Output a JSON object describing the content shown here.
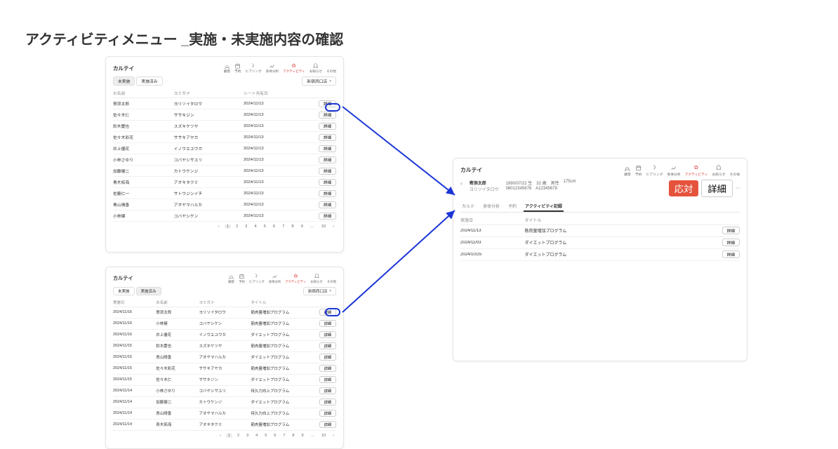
{
  "page_title": "アクティビティメニュー _実施・未実施内容の確認",
  "brand": "カルテイ",
  "toolbar_icons": [
    "顧客",
    "予約",
    "ヒアリング",
    "身体分析",
    "アクティビティ",
    "お知らせ",
    "その他"
  ],
  "shop_dropdown": "新宿西口店",
  "tabs": {
    "pending": "未実施",
    "done": "実施済み"
  },
  "top": {
    "active_tab": "pending",
    "columns": [
      "お名前",
      "ヨミガナ",
      "シート共有日"
    ],
    "rows": [
      {
        "name": "寄添太郎",
        "kana": "ヨリソイタロウ",
        "date": "2024/11/13"
      },
      {
        "name": "佐々木仁",
        "kana": "ササキジン",
        "date": "2024/11/13"
      },
      {
        "name": "鈴木慶也",
        "kana": "スズキケツヤ",
        "date": "2024/11/13"
      },
      {
        "name": "佐々木彩花",
        "kana": "ササキアヤカ",
        "date": "2024/11/13"
      },
      {
        "name": "井上優花",
        "kana": "イノウエユウカ",
        "date": "2024/11/13"
      },
      {
        "name": "小林さゆり",
        "kana": "コバヤシサユリ",
        "date": "2024/11/13"
      },
      {
        "name": "加藤健二",
        "kana": "カトウケンジ",
        "date": "2024/11/13"
      },
      {
        "name": "青木拓海",
        "kana": "アオキタクミ",
        "date": "2024/11/13"
      },
      {
        "name": "佐藤仁一",
        "kana": "サトウジンイチ",
        "date": "2024/11/13"
      },
      {
        "name": "青山晴香",
        "kana": "アオヤマハルカ",
        "date": "2024/11/13"
      },
      {
        "name": "小林健",
        "kana": "コバヤシケン",
        "date": "2024/11/13"
      }
    ],
    "detail_label": "詳細",
    "pagination": {
      "pages": [
        "1",
        "2",
        "3",
        "4",
        "5",
        "6",
        "7",
        "8",
        "9",
        "…",
        "10"
      ],
      "current": "1"
    }
  },
  "bottom": {
    "active_tab": "done",
    "columns": [
      "実施日",
      "お名前",
      "ヨミガナ",
      "タイトル"
    ],
    "rows": [
      {
        "date": "2024/11/16",
        "name": "寄添太郎",
        "kana": "ヨリソイタロウ",
        "title": "筋肉量増加プログラム"
      },
      {
        "date": "2024/11/16",
        "name": "小林健",
        "kana": "コバヤシケン",
        "title": "筋肉量増加プログラム"
      },
      {
        "date": "2024/11/16",
        "name": "井上優花",
        "kana": "イノウエユウカ",
        "title": "ダイエットプログラム"
      },
      {
        "date": "2024/11/15",
        "name": "鈴木慶也",
        "kana": "スズキケツヤ",
        "title": "筋肉量増加プログラム"
      },
      {
        "date": "2024/11/15",
        "name": "青山晴香",
        "kana": "アオヤマハルカ",
        "title": "ダイエットプログラム"
      },
      {
        "date": "2024/11/15",
        "name": "佐々木彩花",
        "kana": "ササキアヤカ",
        "title": "筋肉量増加プログラム"
      },
      {
        "date": "2024/11/15",
        "name": "佐々木仁",
        "kana": "ササキジン",
        "title": "ダイエットプログラム"
      },
      {
        "date": "2024/11/14",
        "name": "小林さゆり",
        "kana": "コバヤシサユリ",
        "title": "持久力向上プログラム"
      },
      {
        "date": "2024/11/14",
        "name": "加藤健二",
        "kana": "カトウケンジ",
        "title": "ダイエットプログラム"
      },
      {
        "date": "2024/11/14",
        "name": "青山晴香",
        "kana": "アオヤマハルカ",
        "title": "持久力向上プログラム"
      },
      {
        "date": "2024/11/14",
        "name": "青木拓海",
        "kana": "アオキタクミ",
        "title": "筋肉量増加プログラム"
      }
    ],
    "detail_label": "詳細",
    "pagination": {
      "pages": [
        "1",
        "2",
        "3",
        "4",
        "5",
        "6",
        "7",
        "8",
        "9",
        "…",
        "10"
      ],
      "current": "1"
    }
  },
  "detail": {
    "name": "寄添太郎",
    "kana": "ヨリソイタロウ",
    "birth": "1990/07/22 生",
    "age": "32 歳",
    "sex": "男性",
    "height": "175cm",
    "phone": "08012345678",
    "code": "A12345678",
    "action_primary": "応対",
    "action_secondary": "詳細",
    "tabs": [
      "カルテ",
      "身体分析",
      "予約",
      "アクティビティ記録"
    ],
    "active_tab_label": "アクティビティ記録",
    "columns": [
      "実施日",
      "タイトル"
    ],
    "rows": [
      {
        "date": "2024/11/13",
        "title": "筋肉量増加プログラム"
      },
      {
        "date": "2024/11/03",
        "title": "ダイエットプログラム"
      },
      {
        "date": "2024/10/25",
        "title": "ダイエットプログラム"
      }
    ],
    "detail_label": "詳細"
  }
}
